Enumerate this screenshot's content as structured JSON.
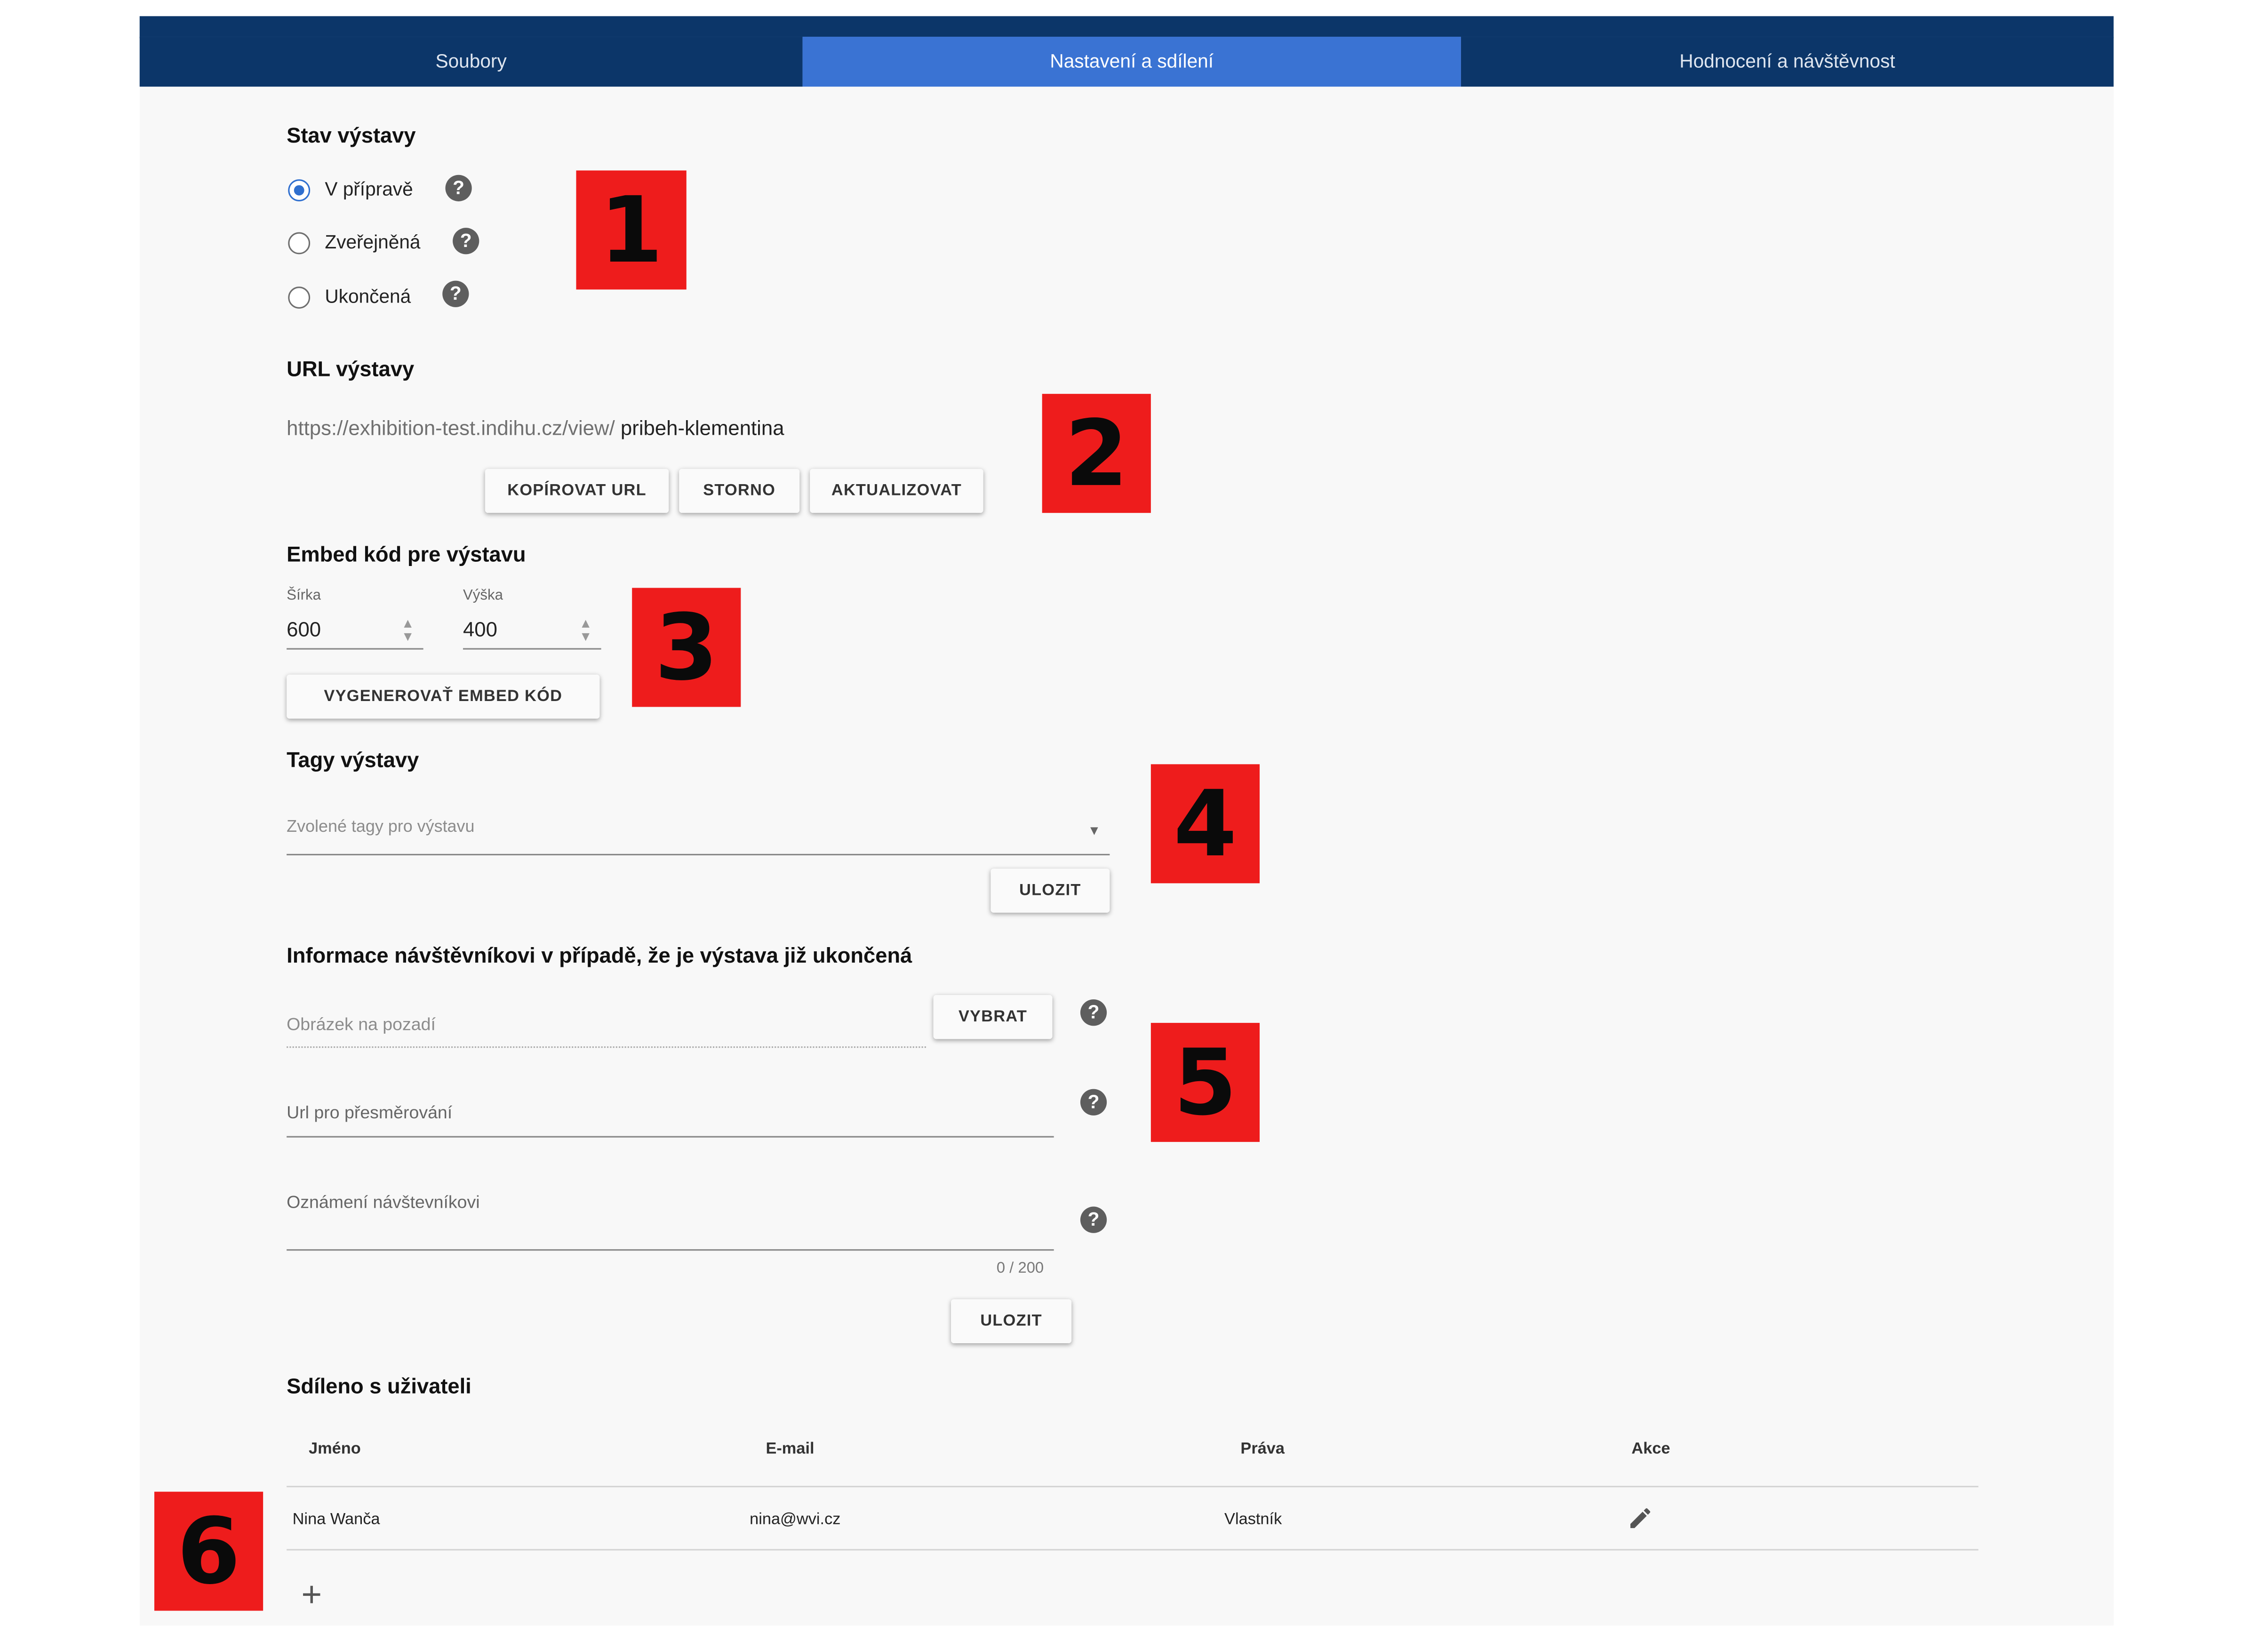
{
  "tabs": [
    "Soubory",
    "Nastavení a sdílení",
    "Hodnocení a návštěvnost"
  ],
  "status": {
    "heading": "Stav výstavy",
    "options": [
      "V přípravě",
      "Zveřejněná",
      "Ukončená"
    ],
    "selected": "V přípravě",
    "help_glyph": "?"
  },
  "url": {
    "heading": "URL výstavy",
    "prefix": "https://exhibition-test.indihu.cz/view/",
    "slug": "pribeh-klementina",
    "buttons": {
      "copy": "KOPÍROVAT URL",
      "cancel": "STORNO",
      "update": "AKTUALIZOVAT"
    }
  },
  "embed": {
    "heading": "Embed kód pre výstavu",
    "width_label": "Šírka",
    "width_value": "600",
    "height_label": "Výška",
    "height_value": "400",
    "generate": "VYGENEROVAŤ EMBED KÓD"
  },
  "tags": {
    "heading": "Tagy výstavy",
    "placeholder": "Zvolené tagy pro výstavu",
    "save": "ULOZIT"
  },
  "info": {
    "heading": "Informace návštěvníkovi v případě, že je výstava již ukončená",
    "bg_image": "Obrázek na pozadí",
    "select": "VYBRAT",
    "redirect": "Url pro přesměrování",
    "notice": "Oznámení návštevníkovi",
    "counter": "0 / 200",
    "save": "ULOZIT"
  },
  "shared": {
    "heading": "Sdíleno s uživateli",
    "columns": [
      "Jméno",
      "E-mail",
      "Práva",
      "Akce"
    ],
    "rows": [
      {
        "name": "Nina Wanča",
        "email": "nina@wvi.cz",
        "rights": "Vlastník"
      }
    ],
    "add_glyph": "+"
  },
  "badges": [
    "1",
    "2",
    "3",
    "4",
    "5",
    "6"
  ],
  "colors": {
    "nav": "#0c3669",
    "active_tab": "#3a73d3",
    "badge": "#ee1c1c",
    "radio": "#2f6fcf"
  }
}
